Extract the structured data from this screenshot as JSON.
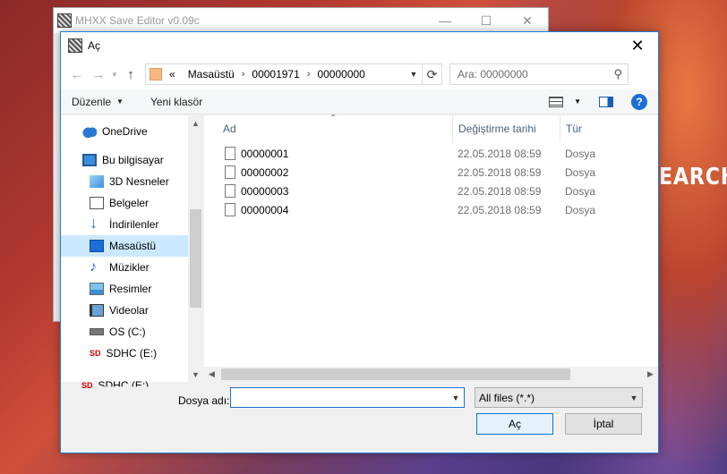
{
  "background": {
    "text": "EARCH"
  },
  "app_window": {
    "title": "MHXX Save Editor v0.09c",
    "minimize": "—",
    "maximize": "☐",
    "close": "✕"
  },
  "dialog": {
    "title": "Aç",
    "close": "✕",
    "nav": {
      "back": "←",
      "forward": "→",
      "up": "↑"
    },
    "address": {
      "prefix": "«",
      "crumbs": [
        "Masaüstü",
        "00001971",
        "00000000"
      ],
      "sep": "›"
    },
    "search": {
      "placeholder": "Ara: 00000000"
    },
    "toolbar": {
      "organize": "Düzenle",
      "new_folder": "Yeni klasör",
      "help": "?"
    },
    "nav_pane": {
      "items": [
        {
          "label": "OneDrive",
          "icon": "onedrive-icon"
        },
        {
          "label": "Bu bilgisayar",
          "icon": "computer-icon"
        },
        {
          "label": "3D Nesneler",
          "icon": "3d-objects-icon"
        },
        {
          "label": "Belgeler",
          "icon": "documents-icon"
        },
        {
          "label": "İndirilenler",
          "icon": "downloads-icon"
        },
        {
          "label": "Masaüstü",
          "icon": "desktop-icon",
          "selected": true
        },
        {
          "label": "Müzikler",
          "icon": "music-icon"
        },
        {
          "label": "Resimler",
          "icon": "pictures-icon"
        },
        {
          "label": "Videolar",
          "icon": "videos-icon"
        },
        {
          "label": "OS (C:)",
          "icon": "drive-icon"
        },
        {
          "label": "SDHC (E:)",
          "icon": "sd-card-icon"
        },
        {
          "label": "SDHC (E:)",
          "icon": "sd-card-icon"
        }
      ],
      "sd_badge": "SD"
    },
    "columns": {
      "name": "Ad",
      "date": "Değiştirme tarihi",
      "type": "Tür"
    },
    "files": [
      {
        "name": "00000001",
        "date": "22.05.2018 08:59",
        "type": "Dosya"
      },
      {
        "name": "00000002",
        "date": "22.05.2018 08:59",
        "type": "Dosya"
      },
      {
        "name": "00000003",
        "date": "22.05.2018 08:59",
        "type": "Dosya"
      },
      {
        "name": "00000004",
        "date": "22.05.2018 08:59",
        "type": "Dosya"
      }
    ],
    "bottom": {
      "filename_label": "Dosya adı:",
      "filename_value": "",
      "filetype": "All files (*.*)",
      "open": "Aç",
      "cancel": "İptal"
    }
  }
}
